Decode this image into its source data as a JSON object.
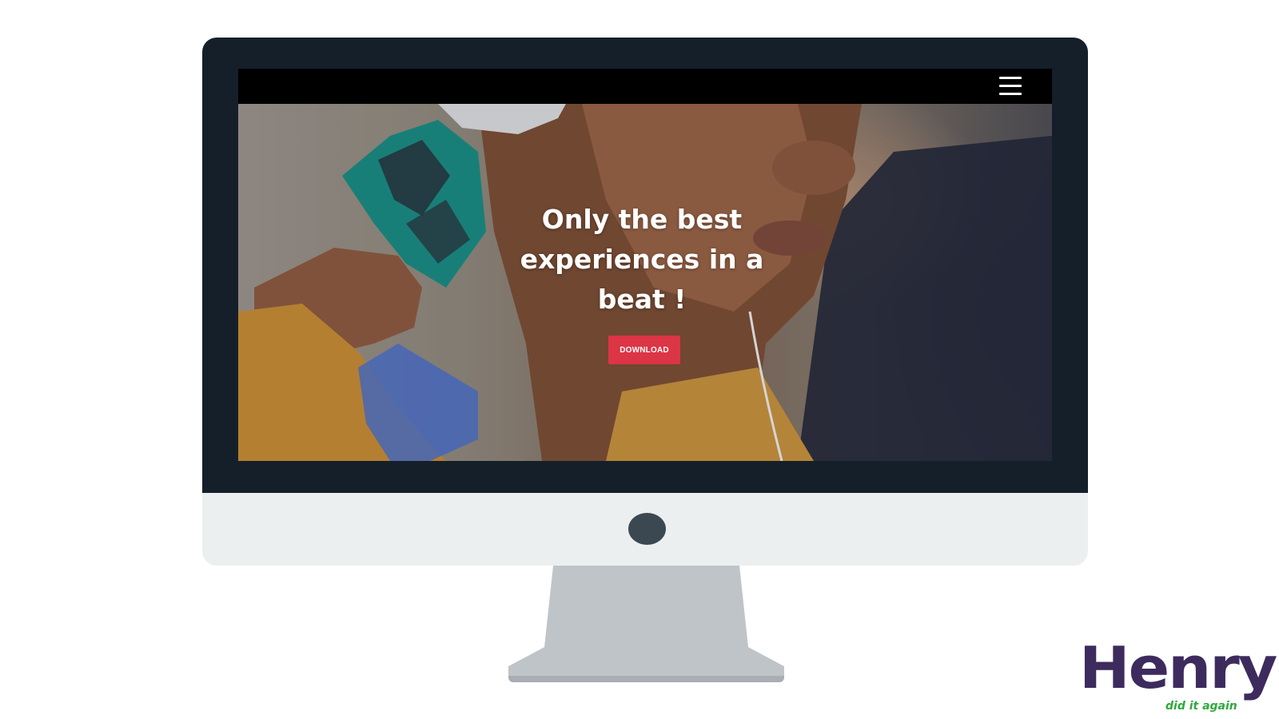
{
  "navbar": {
    "menu_icon": "hamburger-menu-icon"
  },
  "hero": {
    "title": "Only the best experiences in a beat !",
    "cta_label": "DOWNLOAD",
    "cta_color": "#dc3545"
  },
  "monitor": {
    "bezel_color": "#151f2a",
    "chin_color": "#eceff0",
    "stand_color": "#bfc4c8"
  },
  "logo": {
    "wordmark": "Henry",
    "tagline": "did it again",
    "wordmark_color": "#3d2b5e",
    "tagline_color": "#2eaa3c"
  }
}
